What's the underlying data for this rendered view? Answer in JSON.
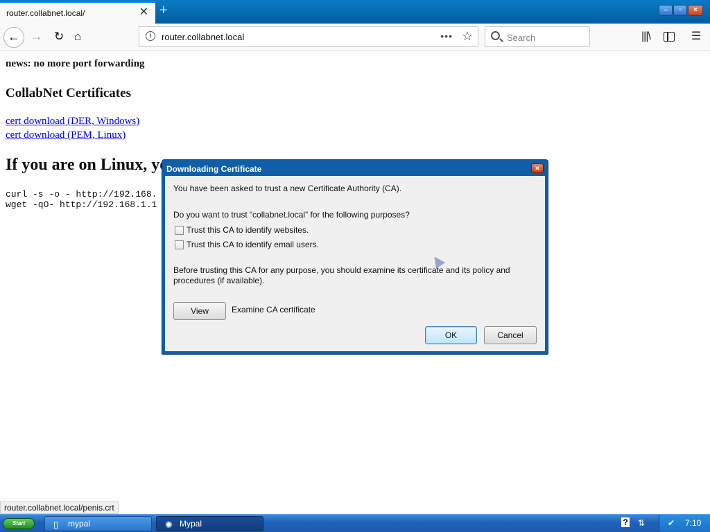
{
  "browser": {
    "tab_title": "router.collabnet.local/",
    "tab_close_glyph": "✕",
    "newtab_glyph": "+",
    "url": "router.collabnet.local",
    "url_dots": "•••",
    "search_placeholder": "Search"
  },
  "page": {
    "news": "news: no more port forwarding",
    "heading": "CollabNet Certificates",
    "links": [
      "cert download (DER, Windows)",
      "cert download (PEM, Linux)"
    ],
    "linux_heading": "If you are on Linux, yo",
    "commands": [
      "curl -s -o - http://192.168.",
      "wget -qO- http://192.168.1.1"
    ]
  },
  "dialog": {
    "title": "Downloading Certificate",
    "intro": "You have been asked to trust a new Certificate Authority (CA).",
    "question": "Do you want to trust “collabnet.local” for the following purposes?",
    "checkboxes": [
      "Trust this CA to identify websites.",
      "Trust this CA to identify email users."
    ],
    "advice_line1": "Before trusting this CA for any purpose, you should examine its certificate and its policy and",
    "advice_line2": "procedures (if available).",
    "view_button": "View",
    "view_description": "Examine CA certificate",
    "ok_button": "OK",
    "cancel_button": "Cancel"
  },
  "status_text": "router.collabnet.local/penis.crt",
  "taskbar": {
    "start_label": "Start",
    "tasks": [
      "mypal",
      "Mypal"
    ],
    "tray_help": "?",
    "clock": "7:10"
  },
  "colors": {
    "tabstrip": "#045c9e",
    "dialog_frame": "#0f5ea8",
    "link": "#0000ee",
    "taskbar": "#1f61b8"
  }
}
